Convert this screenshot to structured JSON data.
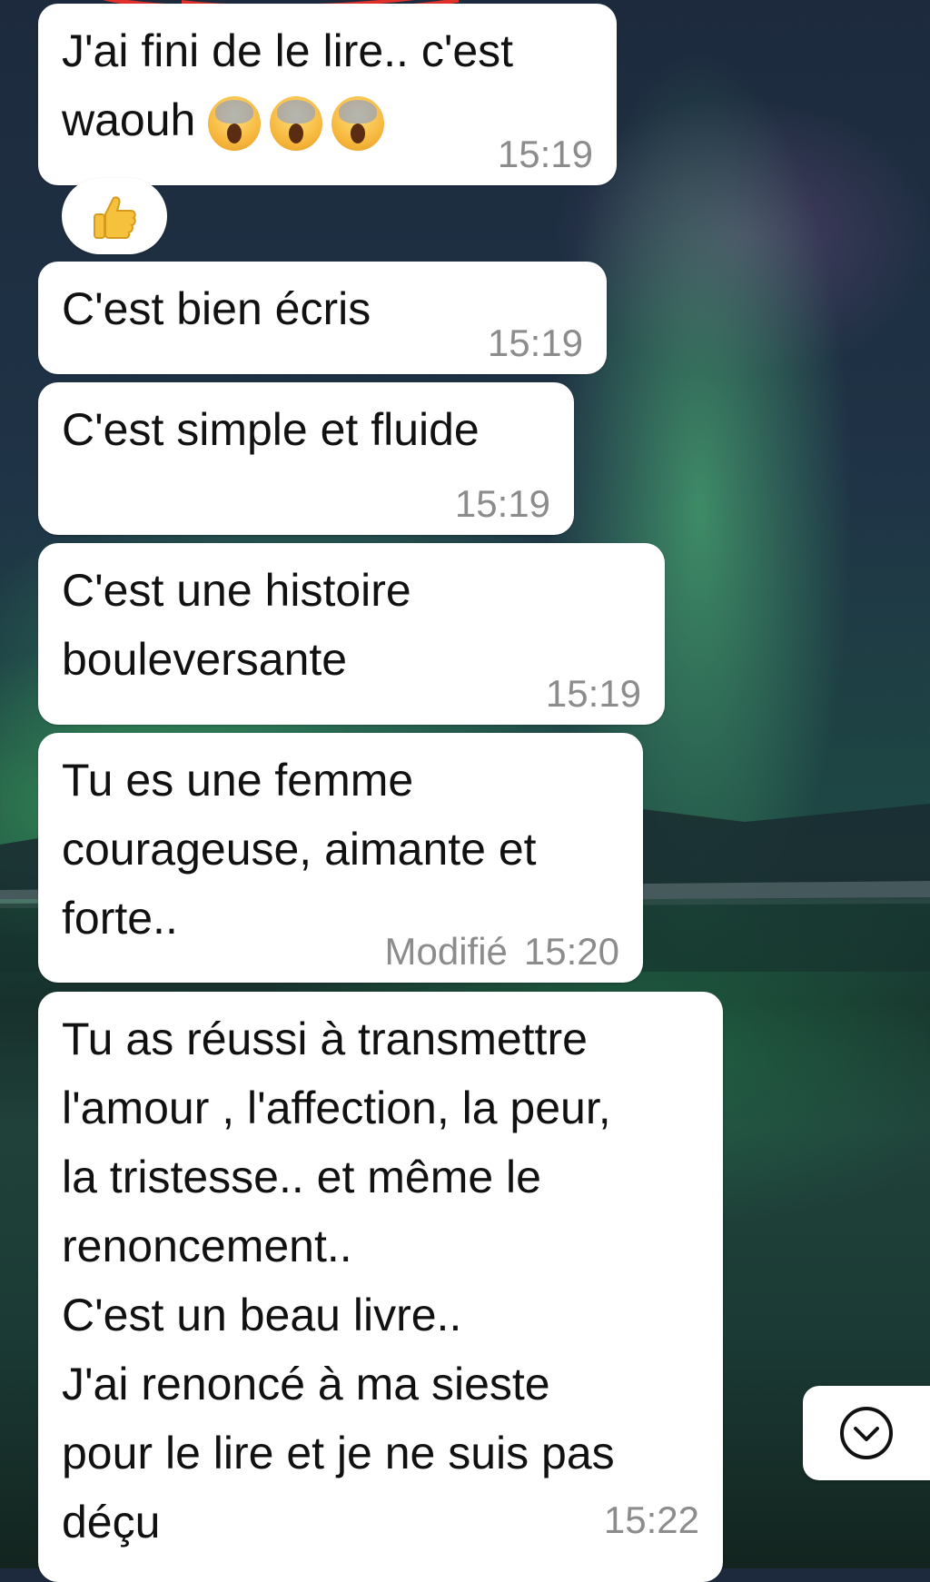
{
  "messages": [
    {
      "text": "J'ai fini de le lire.. c'est\nwaouh",
      "emojis": [
        "face-screaming-in-fear-icon",
        "face-screaming-in-fear-icon",
        "face-screaming-in-fear-icon"
      ],
      "time": "15:19"
    },
    {
      "text": "C'est bien écris",
      "time": "15:19"
    },
    {
      "text": "C'est simple et fluide",
      "time": "15:19"
    },
    {
      "text": "C'est une histoire\nbouleversante",
      "time": "15:19"
    },
    {
      "text": "Tu es une femme\ncourageuse, aimante et\nforte..",
      "edited": "Modifié",
      "time": "15:20"
    },
    {
      "text": "Tu as réussi à transmettre\nl'amour , l'affection, la peur,\nla tristesse.. et même le\nrenoncement..\nC'est un beau livre..\nJ'ai renoncé à ma sieste\npour le lire et je ne suis pas\ndéçu",
      "time": "15:22"
    }
  ],
  "reaction": {
    "icon": "thumbs-up-icon"
  },
  "scroll_button": {
    "icon": "chevron-down-circle-icon"
  },
  "colors": {
    "bubble": "#ffffff",
    "timestamp": "#8c8c8c",
    "annotation": "#e0302a"
  }
}
